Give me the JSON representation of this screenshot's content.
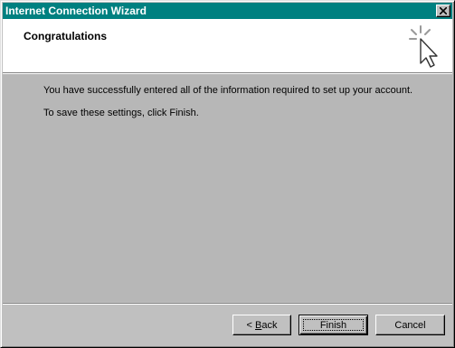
{
  "window": {
    "title": "Internet Connection Wizard",
    "close_icon": "close-icon"
  },
  "header": {
    "title": "Congratulations",
    "icon": "wizard-cursor-icon"
  },
  "content": {
    "line1": "You have successfully entered all of the information required to set up your account.",
    "line2": "To save these settings, click Finish."
  },
  "buttons": {
    "back_prefix": "< ",
    "back_mnemonic": "B",
    "back_rest": "ack",
    "finish": "Finish",
    "cancel": "Cancel"
  },
  "colors": {
    "titlebar": "#008080",
    "face": "#c0c0c0",
    "content": "#b7b7b7"
  }
}
